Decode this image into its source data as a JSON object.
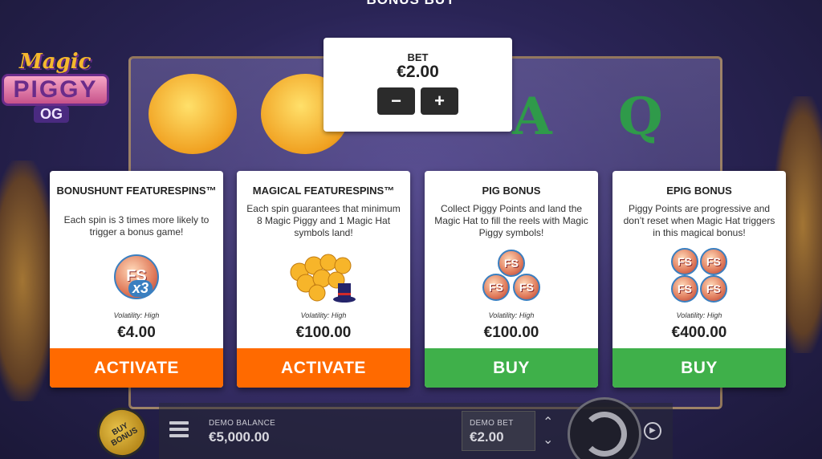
{
  "screen_title": "BONUS BUY",
  "logo": {
    "magic": "Magic",
    "piggy": "PIGGY",
    "og": "OG"
  },
  "bet": {
    "label": "BET",
    "value": "€2.00",
    "minus": "−",
    "plus": "+"
  },
  "cards": [
    {
      "title": "BONUSHUNT FEATURESPINS™",
      "description": "Each spin is 3 times more likely to trigger a bonus game!",
      "icon_text": "x3",
      "volatility": "Volatility: High",
      "price": "€4.00",
      "button": "ACTIVATE",
      "button_color": "#ff6a00"
    },
    {
      "title": "MAGICAL FEATURESPINS™",
      "description": "Each spin guarantees that minimum 8 Magic Piggy and 1 Magic Hat symbols land!",
      "volatility": "Volatility: High",
      "price": "€100.00",
      "button": "ACTIVATE",
      "button_color": "#ff6a00"
    },
    {
      "title": "PIG BONUS",
      "description": "Collect Piggy Points and land the Magic Hat to fill the reels with Magic Piggy symbols!",
      "volatility": "Volatility: High",
      "price": "€100.00",
      "button": "BUY",
      "button_color": "#3fb04a"
    },
    {
      "title": "EPIG BONUS",
      "description": "Piggy Points are progressive and don’t reset when Magic Hat triggers in this magical bonus!",
      "volatility": "Volatility: High",
      "price": "€400.00",
      "button": "BUY",
      "button_color": "#3fb04a"
    }
  ],
  "token_label": "FS",
  "bottom": {
    "buy_bonus": "BUY BONUS",
    "balance_label": "DEMO BALANCE",
    "balance_value": "€5,000.00",
    "bet_label": "DEMO BET",
    "bet_value": "€2.00"
  },
  "background_symbols": [
    "A",
    "Q"
  ]
}
